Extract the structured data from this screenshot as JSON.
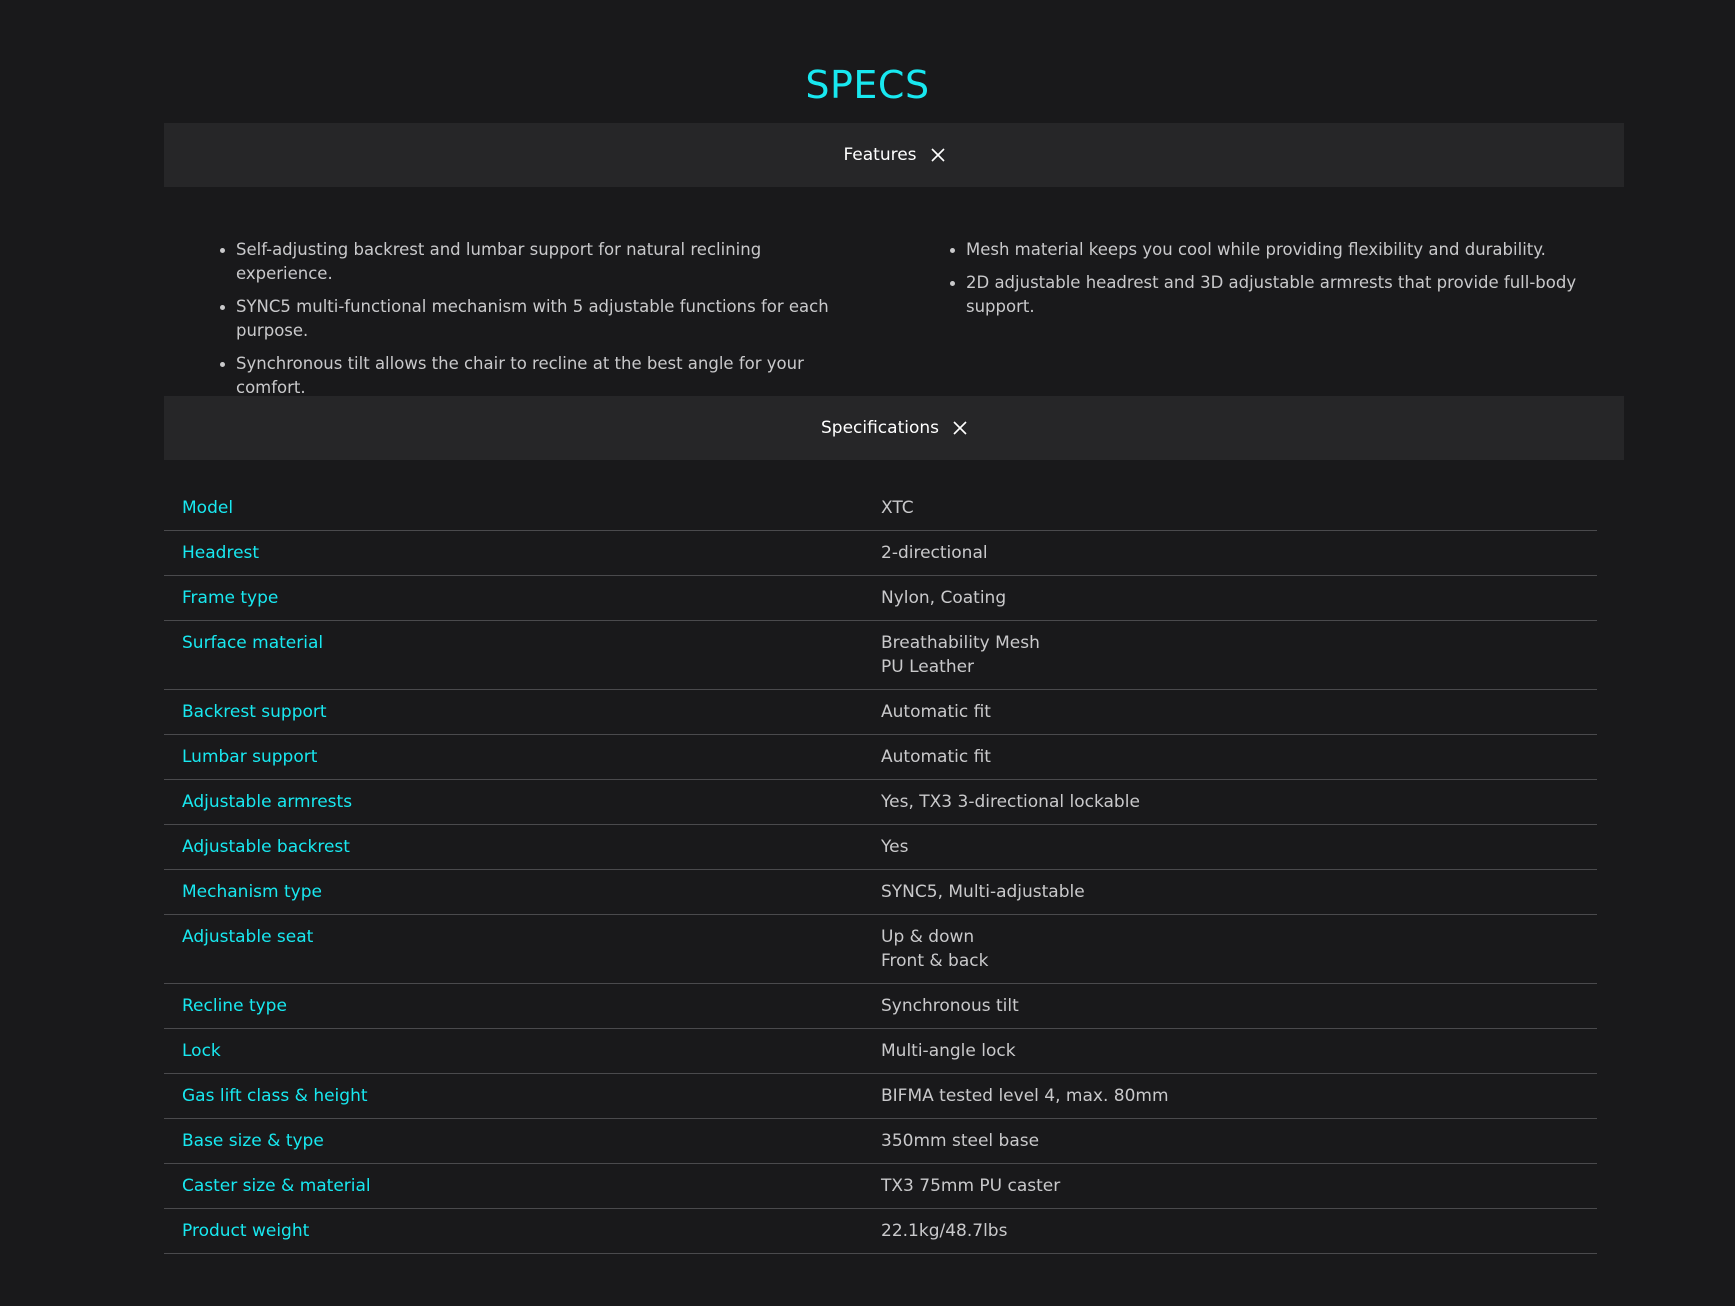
{
  "page_title": "SPECS",
  "features_section": {
    "title": "Features",
    "left_items": [
      "Self-adjusting backrest and lumbar support for natural reclining experience.",
      "SYNC5 multi-functional mechanism with 5 adjustable functions for each purpose.",
      "Synchronous tilt allows the chair to recline at the best angle for your comfort."
    ],
    "right_items": [
      "Mesh material keeps you cool while providing flexibility and durability.",
      "2D adjustable headrest and 3D adjustable armrests that provide full-body support."
    ]
  },
  "specifications_section": {
    "title": "Specifications",
    "rows": [
      {
        "key": "Model",
        "values": [
          "XTC"
        ]
      },
      {
        "key": "Headrest",
        "values": [
          "2-directional"
        ]
      },
      {
        "key": "Frame type",
        "values": [
          "Nylon, Coating"
        ]
      },
      {
        "key": "Surface material",
        "values": [
          "Breathability Mesh",
          "PU Leather"
        ]
      },
      {
        "key": "Backrest support",
        "values": [
          "Automatic fit"
        ]
      },
      {
        "key": "Lumbar support",
        "values": [
          "Automatic fit"
        ]
      },
      {
        "key": "Adjustable armrests",
        "values": [
          "Yes, TX3 3-directional lockable"
        ]
      },
      {
        "key": "Adjustable backrest",
        "values": [
          "Yes"
        ]
      },
      {
        "key": "Mechanism type",
        "values": [
          "SYNC5, Multi-adjustable"
        ]
      },
      {
        "key": "Adjustable seat",
        "values": [
          "Up & down",
          "Front & back"
        ]
      },
      {
        "key": "Recline type",
        "values": [
          "Synchronous tilt"
        ]
      },
      {
        "key": "Lock",
        "values": [
          "Multi-angle lock"
        ]
      },
      {
        "key": "Gas lift class & height",
        "values": [
          "BIFMA tested level 4, max. 80mm"
        ]
      },
      {
        "key": "Base size & type",
        "values": [
          "350mm steel base"
        ]
      },
      {
        "key": "Caster size & material",
        "values": [
          "TX3 75mm PU caster"
        ]
      },
      {
        "key": "Product weight",
        "values": [
          "22.1kg/48.7lbs"
        ]
      }
    ]
  },
  "colors": {
    "background": "#19191b",
    "header_background": "#262628",
    "accent": "#18e8f0",
    "text": "#c9c9cb",
    "divider": "#4a4a4d"
  },
  "icons": {
    "section_toggle": "close-icon"
  }
}
